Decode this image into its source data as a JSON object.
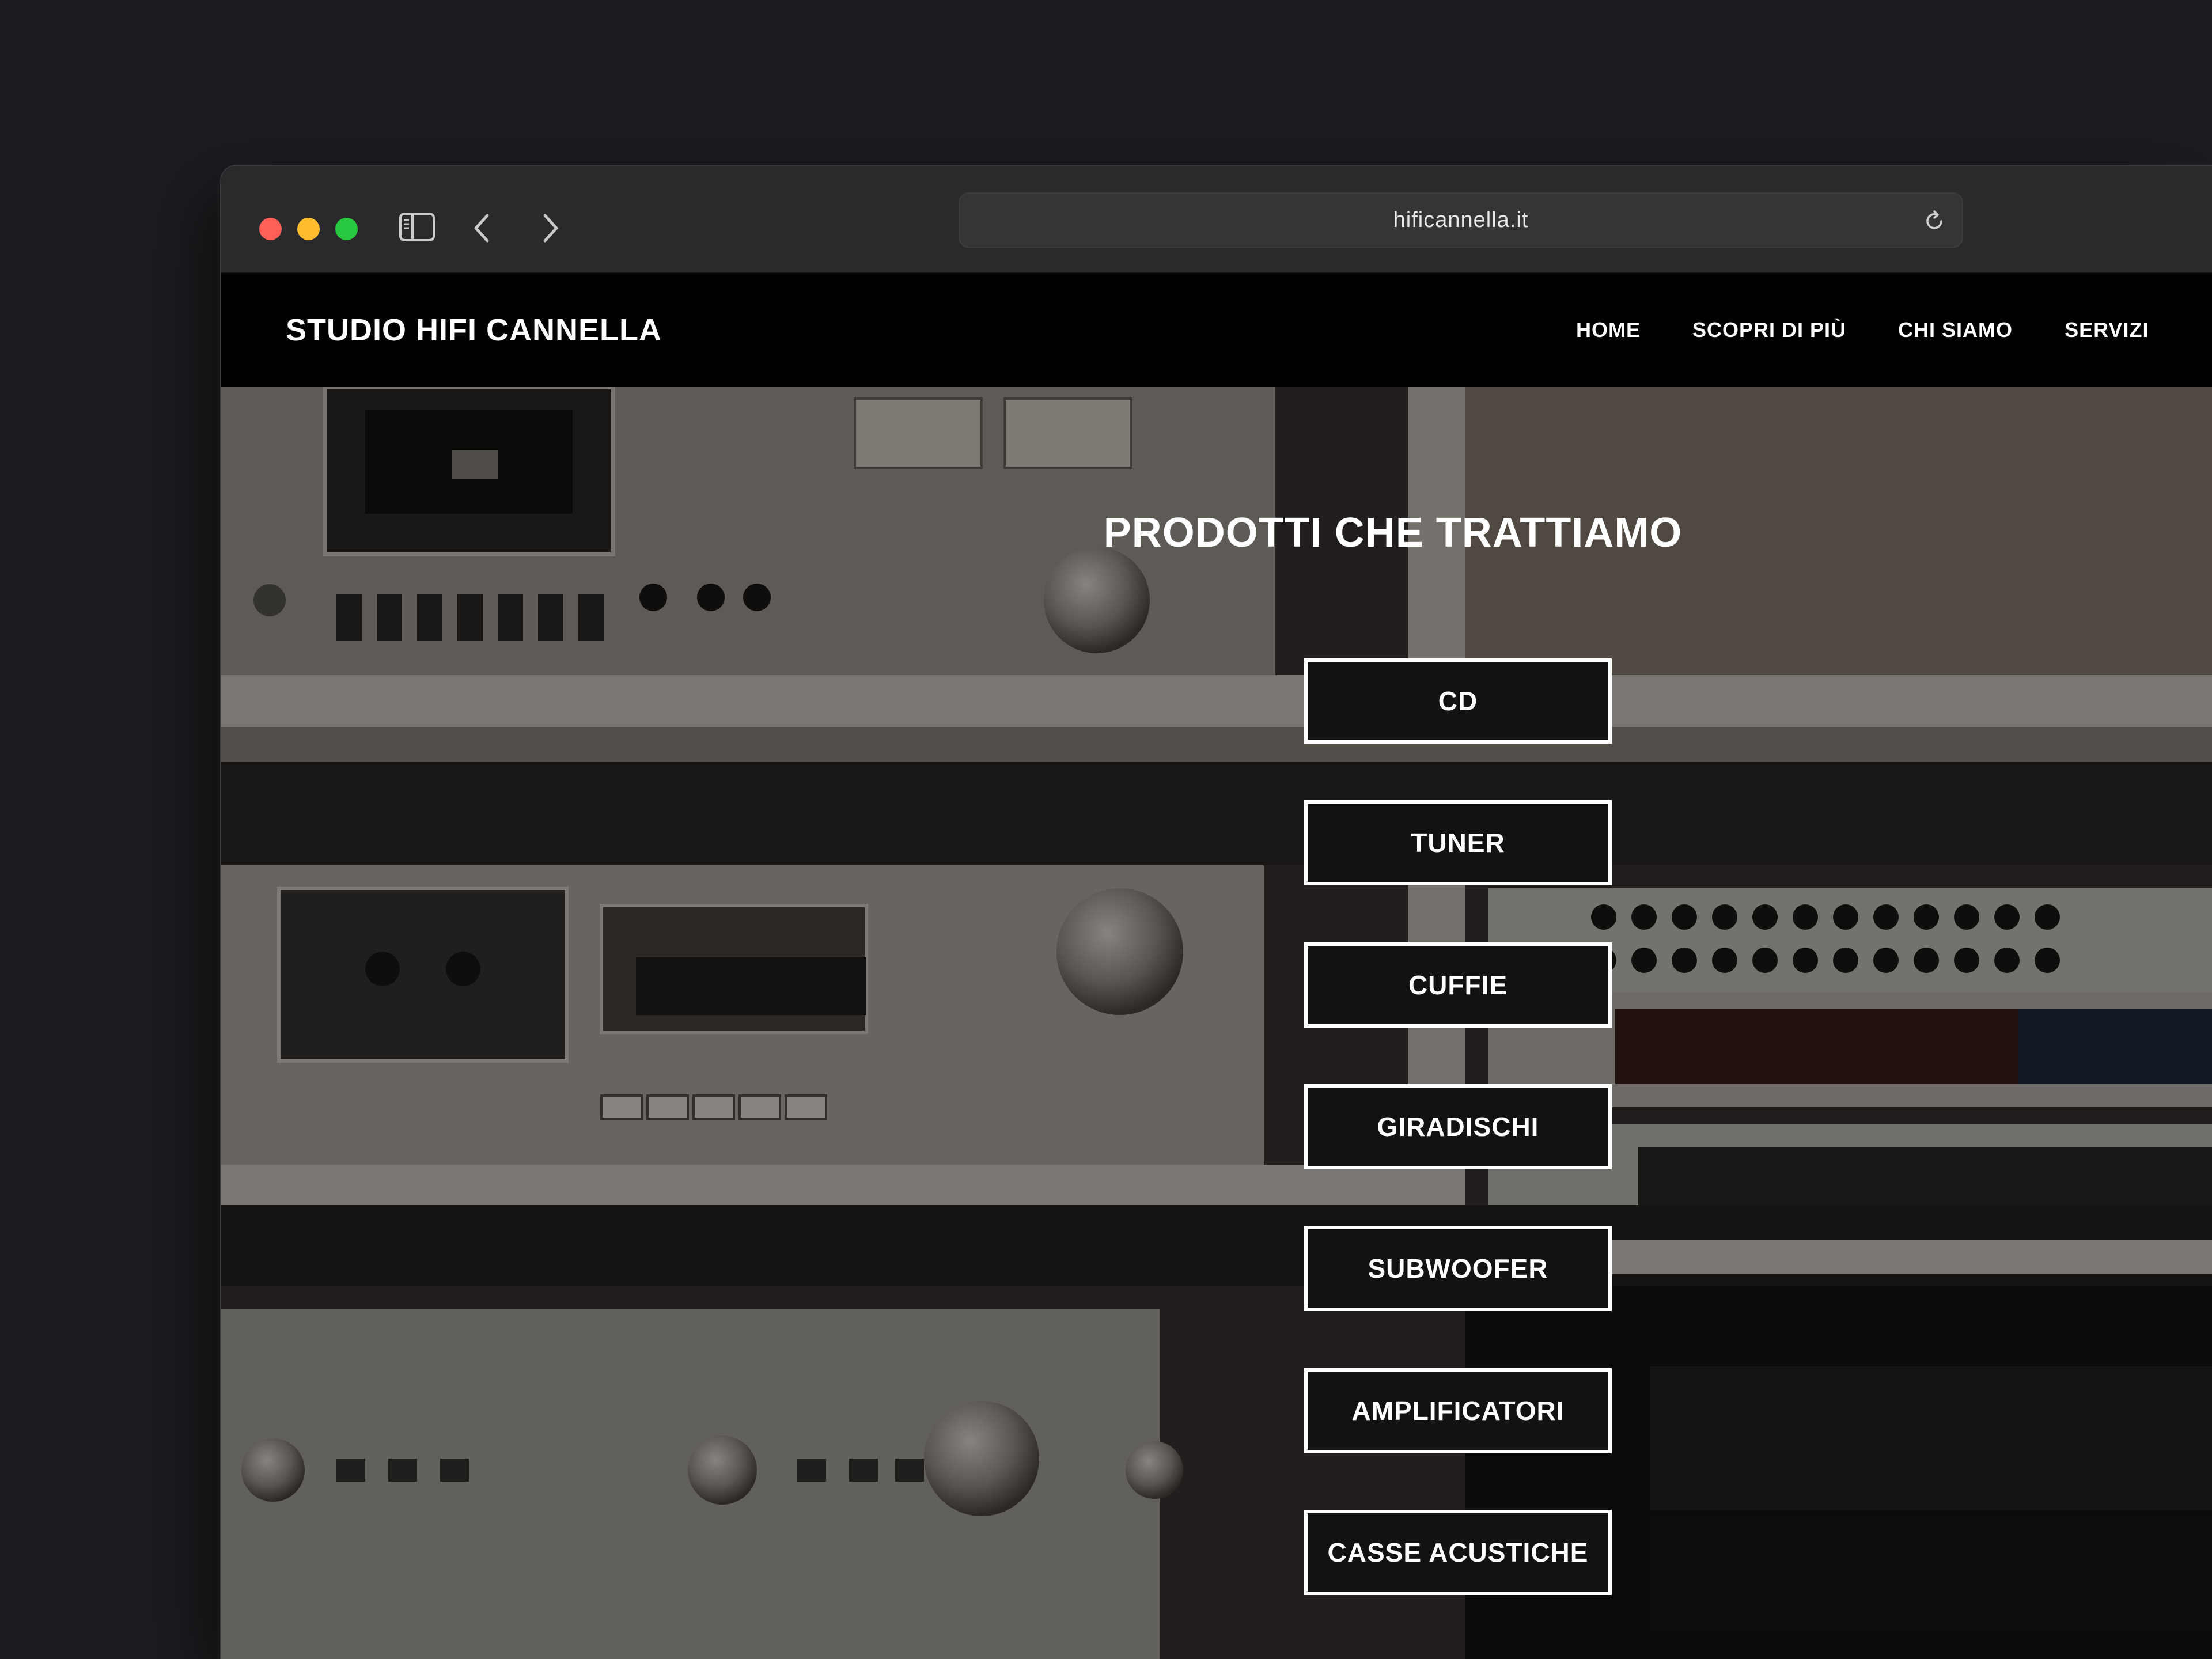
{
  "browser": {
    "url": "hificannella.it",
    "icons": {
      "sidebar": "sidebar-toggle-icon",
      "back": "chevron-left-icon",
      "forward": "chevron-right-icon",
      "reload": "reload-icon"
    }
  },
  "site": {
    "brand": "STUDIO HIFI CANNELLA",
    "nav": [
      "HOME",
      "SCOPRI DI PIÙ",
      "CHI SIAMO",
      "SERVIZI"
    ],
    "hero_title": "PRODOTTI CHE TRATTIAMO",
    "products": [
      "CD",
      "TUNER",
      "CUFFIE",
      "GIRADISCHI",
      "SUBWOOFER",
      "AMPLIFICATORI",
      "CASSE ACUSTICHE"
    ]
  },
  "colors": {
    "page_bg": "#1c1d20",
    "toolbar_bg": "#2a2a2c",
    "navbar_bg": "#000000",
    "button_bg": "#121212",
    "button_border": "#ffffff",
    "traffic_red": "#fe5f57",
    "traffic_yellow": "#febc2e",
    "traffic_green": "#28c840"
  }
}
